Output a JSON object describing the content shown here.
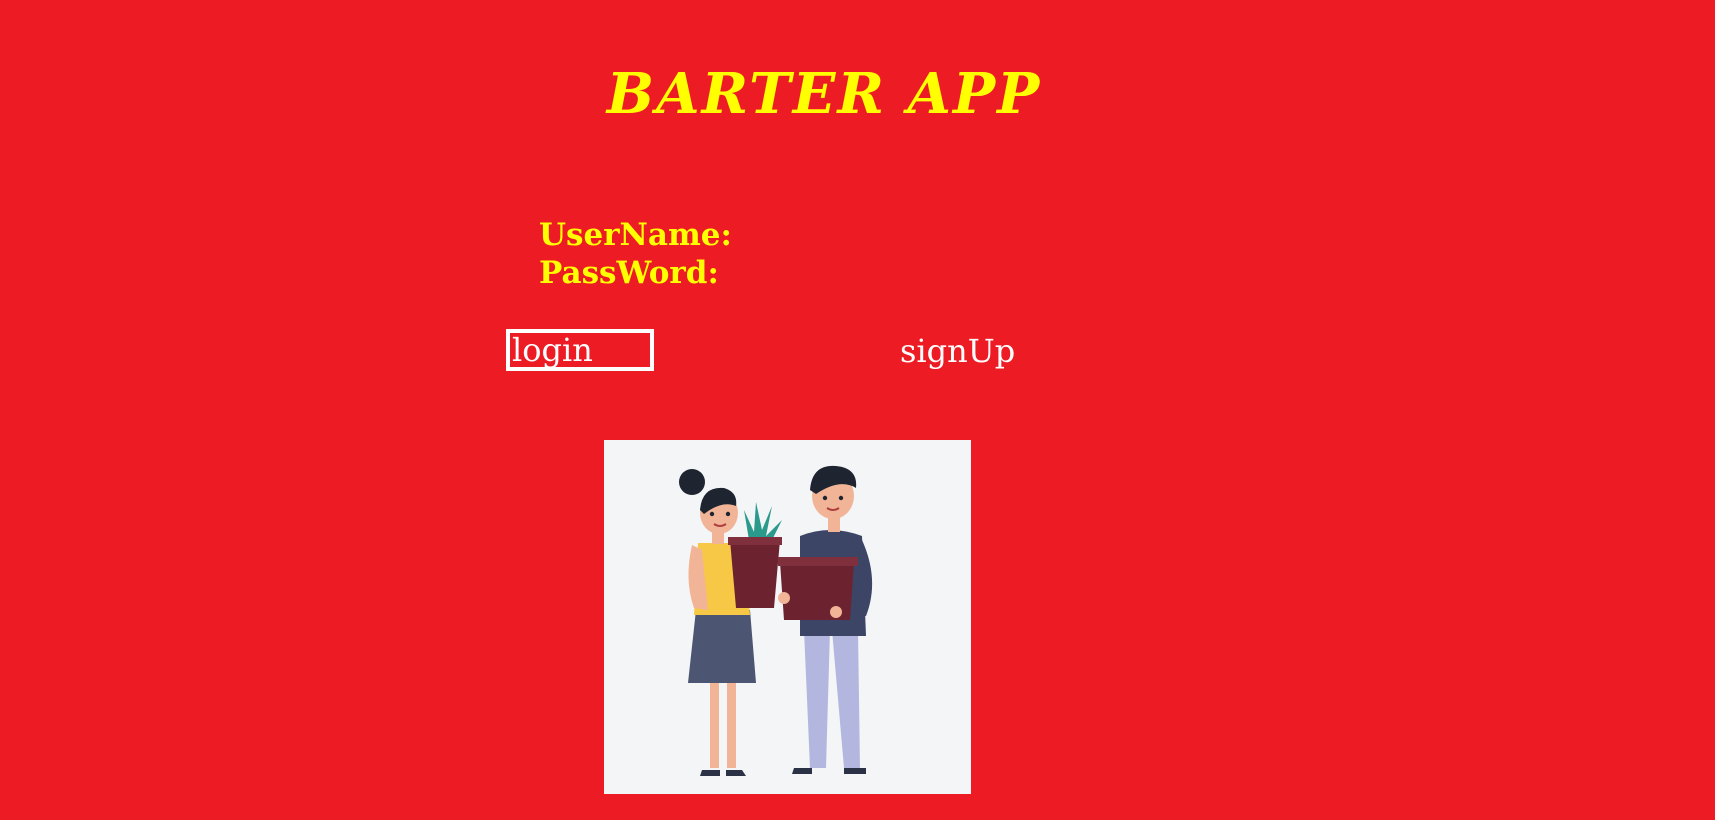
{
  "app": {
    "title": "BARTER APP"
  },
  "form": {
    "username_label": "UserName:",
    "username_value": "",
    "password_label": "PassWord:",
    "password_value": ""
  },
  "actions": {
    "login_label": "login",
    "signup_label": "signUp"
  },
  "illustration": {
    "name": "two-people-holding-plant-pots-illustration"
  },
  "colors": {
    "background": "#ed1c24",
    "title": "#ffff00",
    "labels": "#ffff00",
    "buttons": "#ffffff"
  }
}
